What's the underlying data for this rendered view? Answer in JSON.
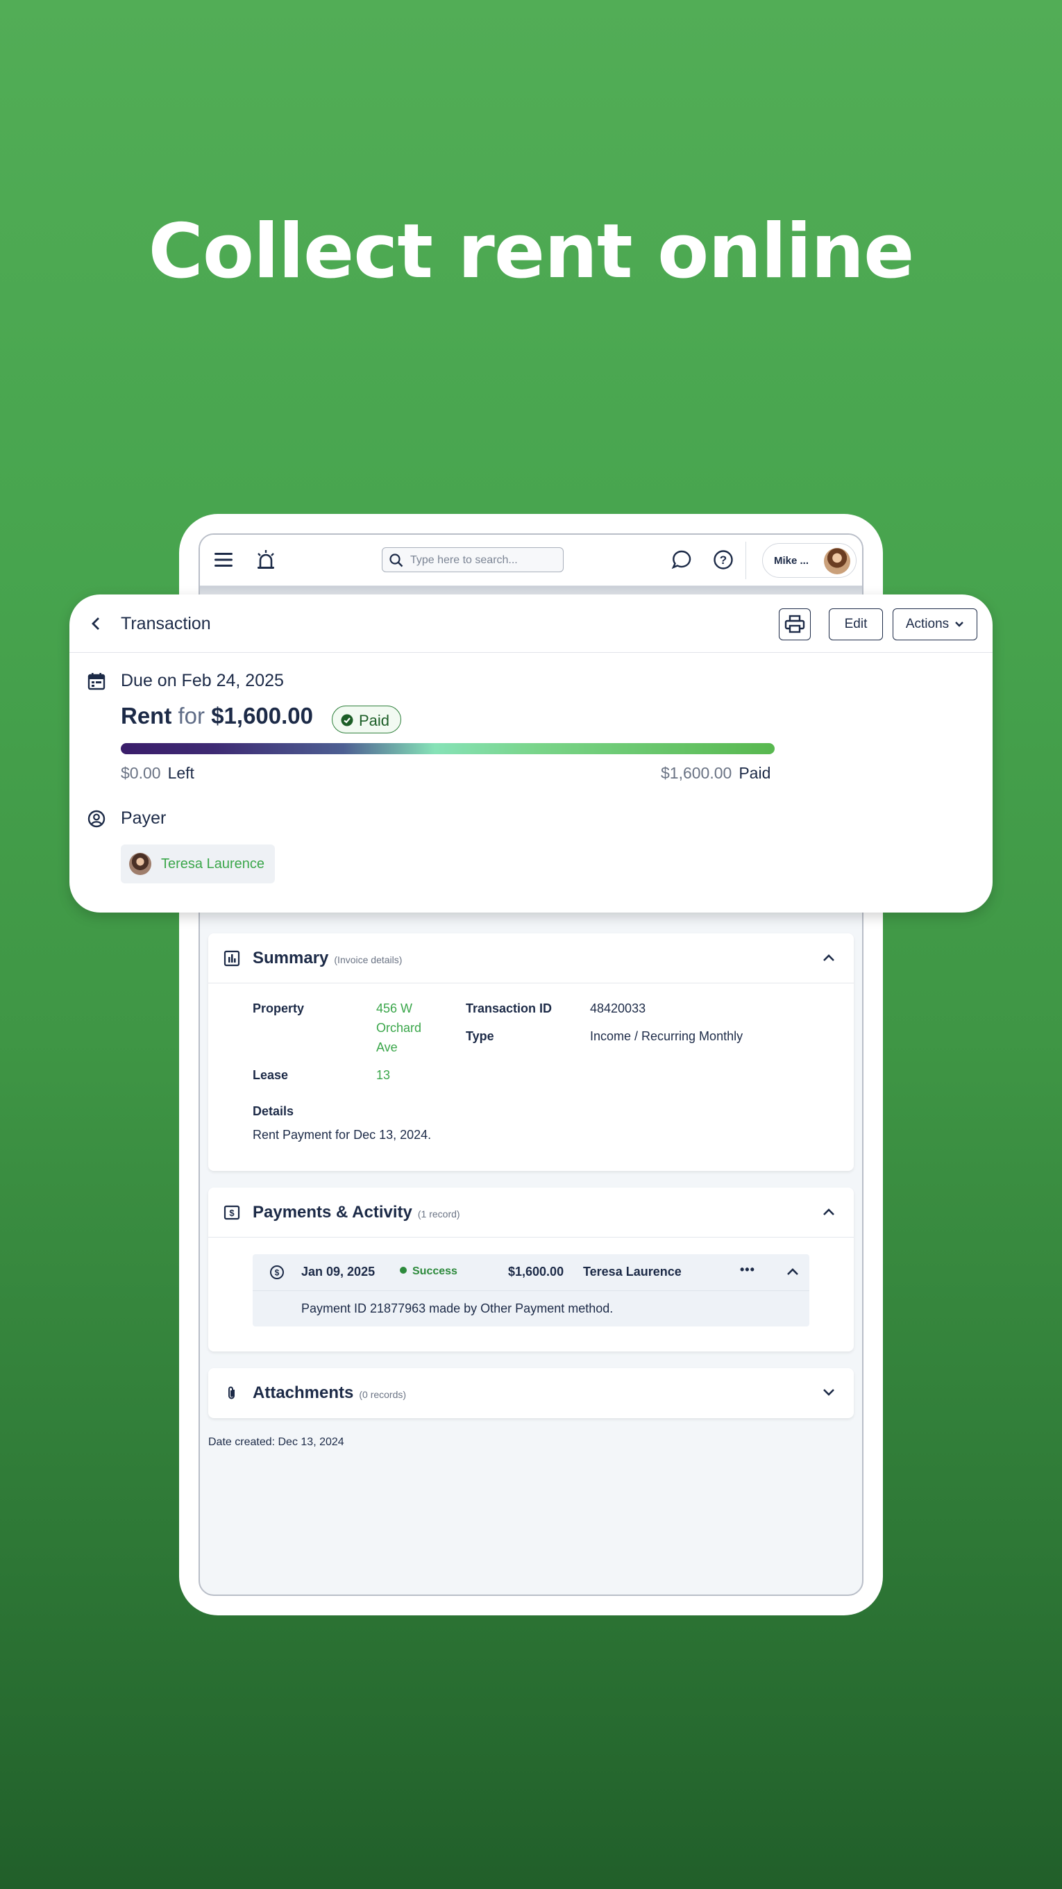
{
  "headline": "Collect rent online",
  "topbar": {
    "search_placeholder": "Type here to search...",
    "user_name": "Mike ..."
  },
  "transaction": {
    "title": "Transaction",
    "edit_label": "Edit",
    "actions_label": "Actions",
    "due_text": "Due on Feb 24, 2025",
    "rent_label": "Rent",
    "for_label": "for",
    "amount": "$1,600.00",
    "status": "Paid",
    "progress_paid_fraction": 1.0,
    "left_amount": "$0.00",
    "left_label": "Left",
    "paid_amount": "$1,600.00",
    "paid_label": "Paid",
    "payer_label": "Payer",
    "payer_name": "Teresa Laurence"
  },
  "summary": {
    "title": "Summary",
    "subtitle": "(Invoice details)",
    "property_label": "Property",
    "property_line1": "456 W",
    "property_line2": "Orchard",
    "property_line3": "Ave",
    "transaction_id_label": "Transaction ID",
    "transaction_id": "48420033",
    "type_label": "Type",
    "type_value": "Income / Recurring Monthly",
    "lease_label": "Lease",
    "lease_value": "13",
    "details_label": "Details",
    "details_value": "Rent Payment for Dec 13, 2024."
  },
  "payments": {
    "title": "Payments & Activity",
    "subtitle": "(1 record)",
    "row": {
      "date": "Jan 09, 2025",
      "status": "Success",
      "amount": "$1,600.00",
      "payer": "Teresa Laurence",
      "more": "•••",
      "description": "Payment ID 21877963 made by Other Payment method."
    }
  },
  "attachments": {
    "title": "Attachments",
    "subtitle": "(0 records)"
  },
  "date_created": "Date created: Dec 13, 2024",
  "colors": {
    "background_top": "#52ad56",
    "background_bottom": "#215f2a",
    "accent_green": "#3aa64a",
    "navy": "#1c2a47"
  }
}
